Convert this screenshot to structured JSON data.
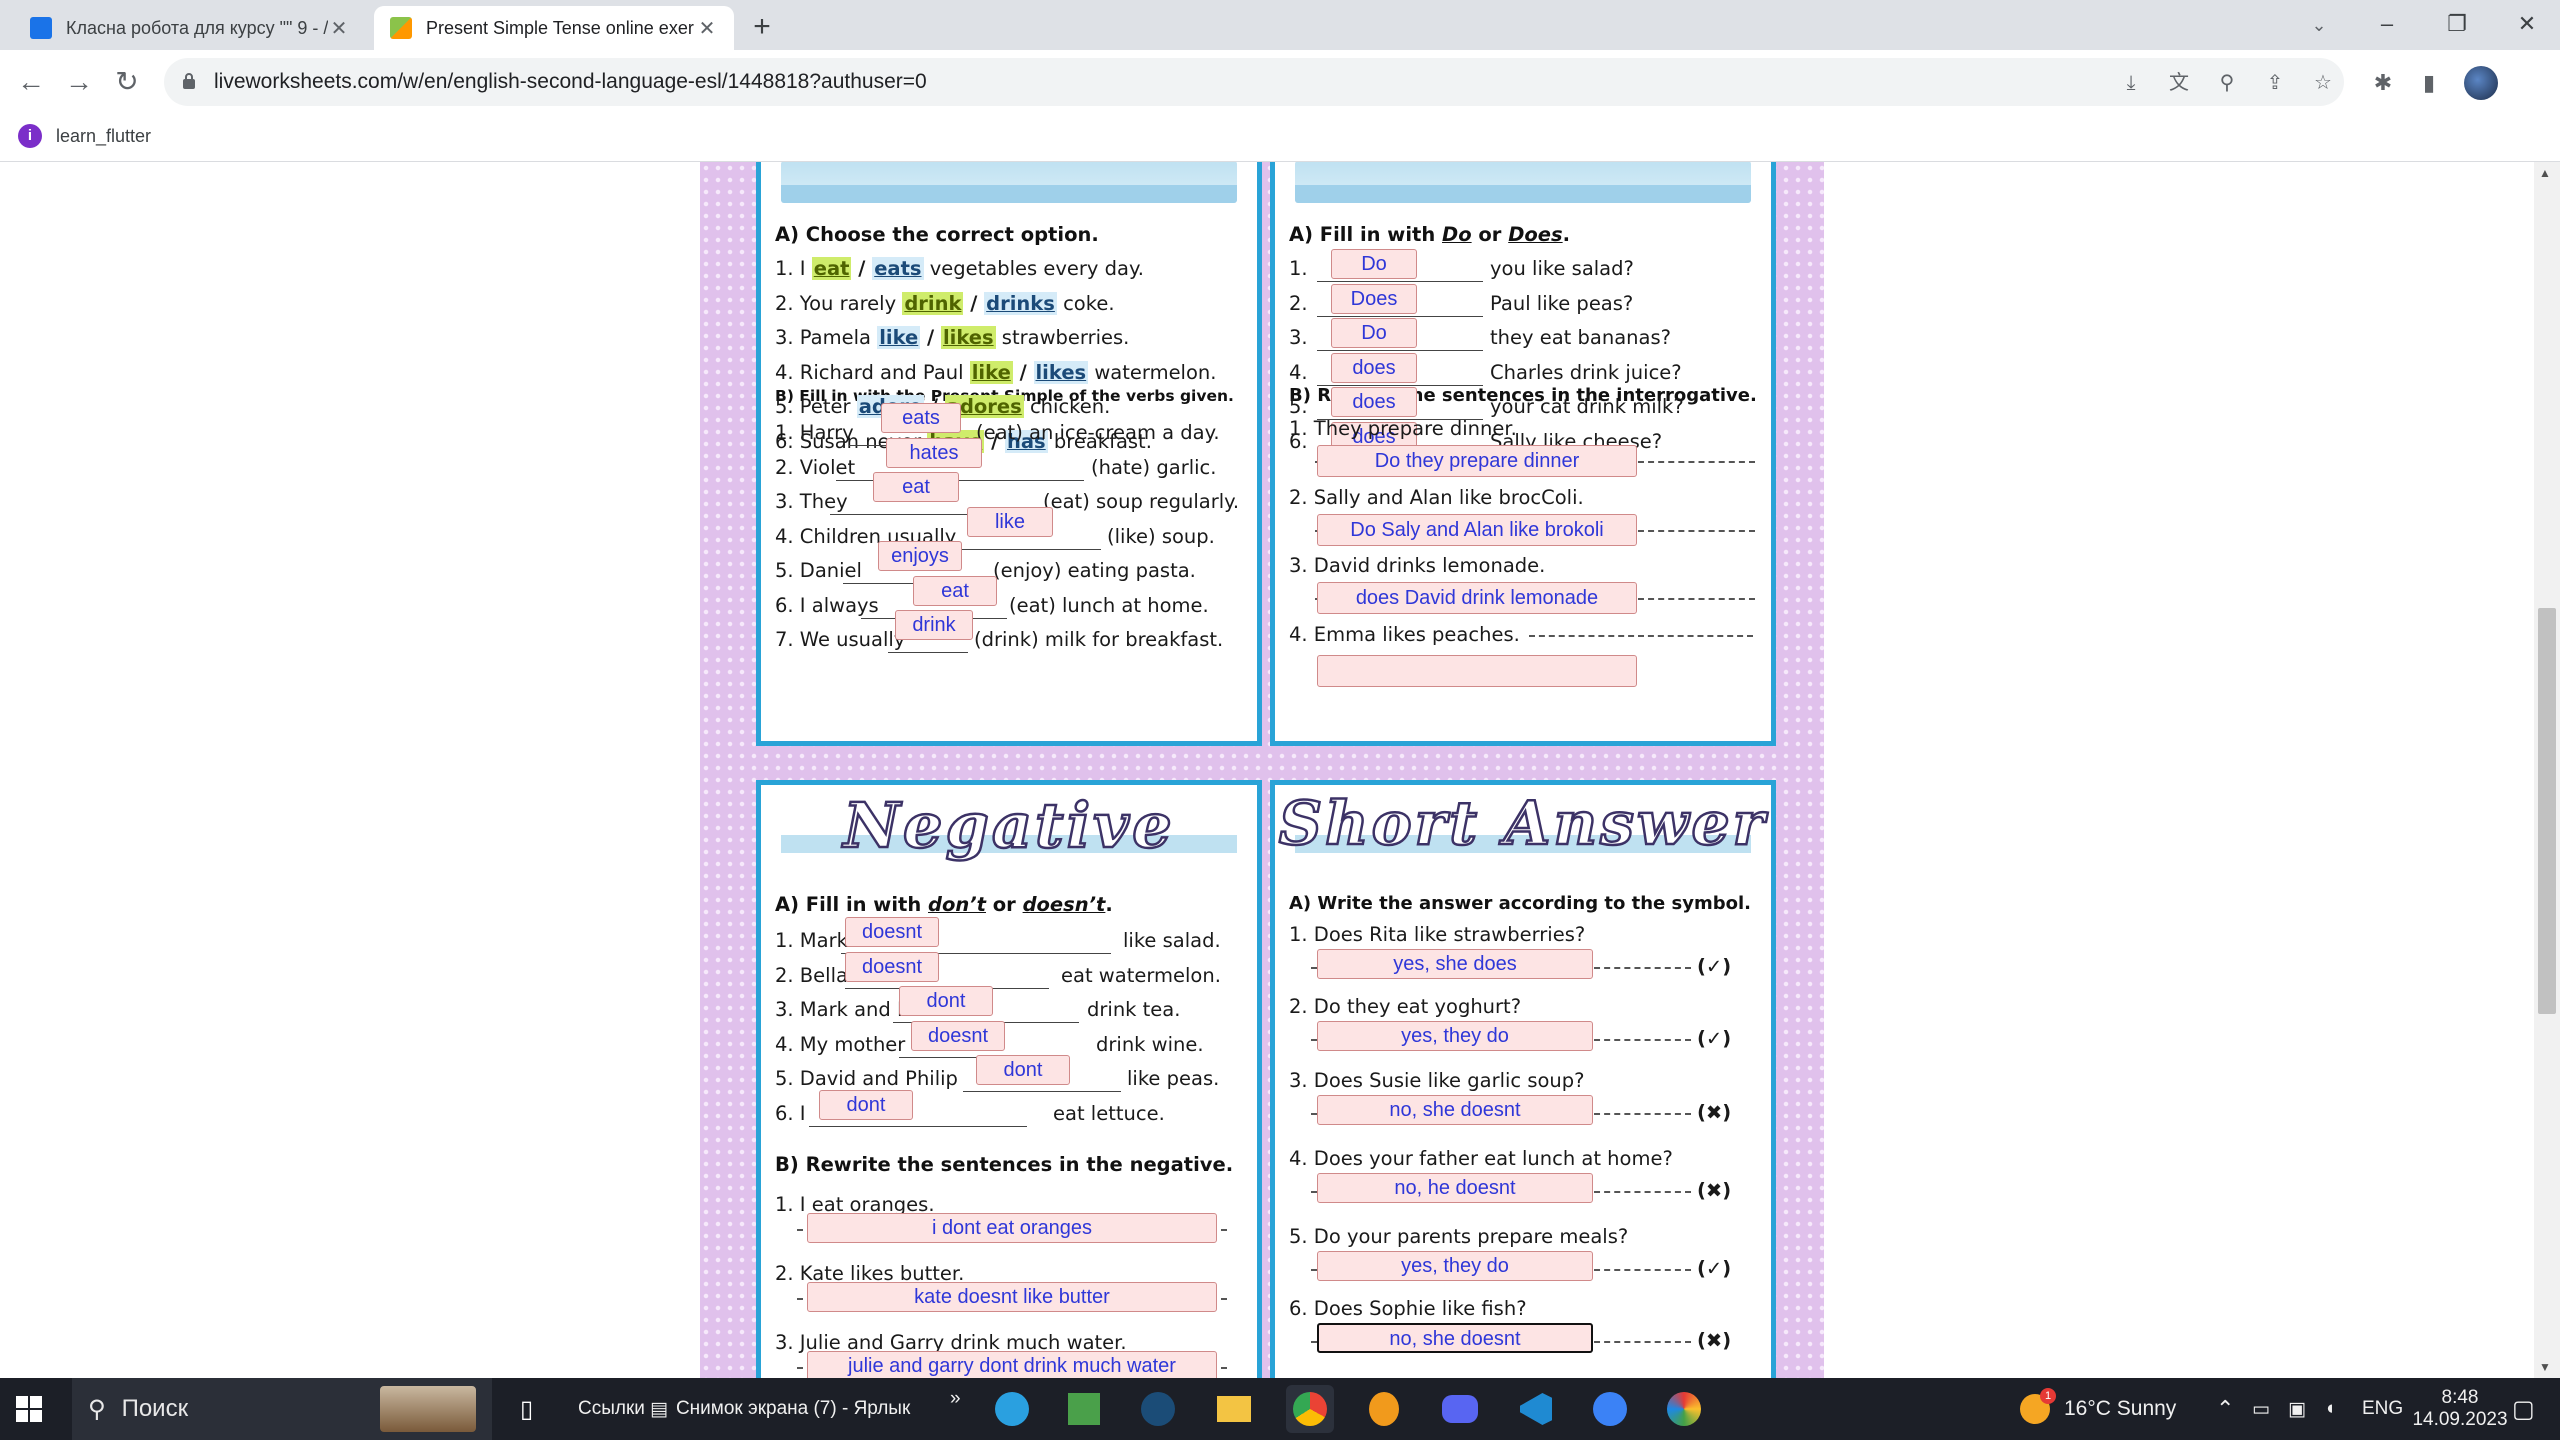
{
  "browser": {
    "tabs": [
      {
        "title": "Класна робота для курсу \"\" 9 - /",
        "active": false
      },
      {
        "title": "Present Simple Tense online exer",
        "active": true
      }
    ],
    "url": "liveworksheets.com/w/en/english-second-language-esl/1448818?authuser=0",
    "bookmark": "learn_flutter"
  },
  "affirmative": {
    "a_heading": "A) Choose the correct option.",
    "a_items": [
      {
        "pre": "1. I ",
        "o1": "eat",
        "sep": " / ",
        "o2": "eats",
        "post": " vegetables every day."
      },
      {
        "pre": "2. You rarely ",
        "o1": "drink",
        "sep": " / ",
        "o2": "drinks",
        "post": " coke."
      },
      {
        "pre": "3. Pamela ",
        "o1": "like",
        "sep": " / ",
        "o2": "likes",
        "post": " strawberries."
      },
      {
        "pre": "4. Richard and Paul ",
        "o1": "like",
        "sep": " / ",
        "o2": "likes",
        "post": " watermelon."
      },
      {
        "pre": "5. Peter ",
        "o1": "adore",
        "sep": " / ",
        "o2": "adores",
        "post": " chicken."
      },
      {
        "pre": "6. Susan never ",
        "o1": "have",
        "sep": " / ",
        "o2": "has",
        "post": " breakfast."
      }
    ],
    "b_heading": "B) Fill in with the Present Simple of the verbs given.",
    "b_items": [
      {
        "pre": "1. Harry",
        "post": "(eat) an ice-cream a day.",
        "answer": "eats"
      },
      {
        "pre": "2. Violet",
        "post": "(hate) garlic.",
        "answer": "hates"
      },
      {
        "pre": "3. They",
        "post": "(eat) soup regularly.",
        "answer": "eat"
      },
      {
        "pre": "4. Children usually",
        "post": "(like) soup.",
        "answer": "like"
      },
      {
        "pre": "5. Daniel",
        "post": "(enjoy) eating pasta.",
        "answer": "enjoys"
      },
      {
        "pre": "6. I always",
        "post": "(eat) lunch at home.",
        "answer": "eat"
      },
      {
        "pre": "7. We usually",
        "post": "(drink) milk for breakfast.",
        "answer": "drink"
      }
    ]
  },
  "interrogative": {
    "a_heading_pre": "A) Fill in with ",
    "a_heading_do": "Do",
    "a_heading_or": " or ",
    "a_heading_does": "Does",
    "a_heading_end": ".",
    "a_items": [
      {
        "num": "1.",
        "post": "you like salad?",
        "answer": "Do"
      },
      {
        "num": "2.",
        "post": "Paul like peas?",
        "answer": "Does"
      },
      {
        "num": "3.",
        "post": "they eat bananas?",
        "answer": "Do"
      },
      {
        "num": "4.",
        "post": "Charles drink juice?",
        "answer": "does"
      },
      {
        "num": "5.",
        "post": "your cat drink milk?",
        "answer": "does"
      },
      {
        "num": "6.",
        "post": "Sally like cheese?",
        "answer": "does"
      }
    ],
    "b_heading": "B) Rewrite the sentences in the interrogative.",
    "b_items": [
      {
        "text": "1. They prepare dinner.",
        "answer": "Do they prepare dinner"
      },
      {
        "text": "2. Sally and Alan like brocColi.",
        "answer": "Do Saly and Alan like brokoli"
      },
      {
        "text": "3. David drinks lemonade.",
        "answer": "does David drink lemonade"
      },
      {
        "text": "4. Emma likes peaches.",
        "answer": ""
      }
    ]
  },
  "negative": {
    "title": "Negative",
    "a_heading_pre": "A) Fill in with ",
    "a_heading_dont": "don’t",
    "a_heading_or": " or ",
    "a_heading_doesnt": "doesn’t",
    "a_heading_end": ".",
    "a_items": [
      {
        "pre": "1. Mark",
        "post": "like salad.",
        "answer": "doesnt"
      },
      {
        "pre": "2. Bella",
        "post": "eat watermelon.",
        "answer": "doesnt"
      },
      {
        "pre": "3. Mark and I",
        "post": "drink tea.",
        "answer": "dont"
      },
      {
        "pre": "4. My mother",
        "post": "drink wine.",
        "answer": "doesnt"
      },
      {
        "pre": "5. David and Philip",
        "post": "like peas.",
        "answer": "dont"
      },
      {
        "pre": "6. I",
        "post": "eat lettuce.",
        "answer": "dont"
      }
    ],
    "b_heading": "B) Rewrite the sentences in the negative.",
    "b_items": [
      {
        "text": "1. I eat oranges.",
        "answer": "i dont eat oranges"
      },
      {
        "text": "2. Kate likes butter.",
        "answer": "kate doesnt like butter"
      },
      {
        "text": "3. Julie and Garry drink much water.",
        "answer": "julie and garry dont drink much water"
      }
    ]
  },
  "short_answer": {
    "title": "Short Answer",
    "a_heading": "A) Write the answer according to the symbol.",
    "items": [
      {
        "q": "1. Does Rita like strawberries?",
        "answer": "yes, she does",
        "symbol": "(✓)"
      },
      {
        "q": "2. Do they eat yoghurt?",
        "answer": "yes, they do",
        "symbol": "(✓)"
      },
      {
        "q": "3. Does Susie like garlic soup?",
        "answer": "no, she doesnt",
        "symbol": "(✖)"
      },
      {
        "q": "4. Does your father eat lunch at home?",
        "answer": "no, he doesnt",
        "symbol": "(✖)"
      },
      {
        "q": "5. Do your parents prepare meals?",
        "answer": "yes, they do",
        "symbol": "(✓)"
      },
      {
        "q": "6. Does Sophie like fish?",
        "answer": "no, she doesnt",
        "symbol": "(✖)"
      }
    ]
  },
  "taskbar": {
    "search_placeholder": "Поиск",
    "links_label": "Ссылки",
    "shortcut_label": "Снимок экрана (7) - Ярлык",
    "chevron": "»",
    "weather": "16°C  Sunny",
    "lang": "ENG",
    "time": "8:48",
    "date": "14.09.2023",
    "weather_badge": "1"
  },
  "colors": {
    "tab_bg": "#dee1e6",
    "panel_border": "#29a3d7",
    "answer_bg": "#fde4e4",
    "answer_text": "#2f37d8",
    "sheet_bg": "#e0c1ec",
    "taskbar_bg": "#1c1f27"
  }
}
